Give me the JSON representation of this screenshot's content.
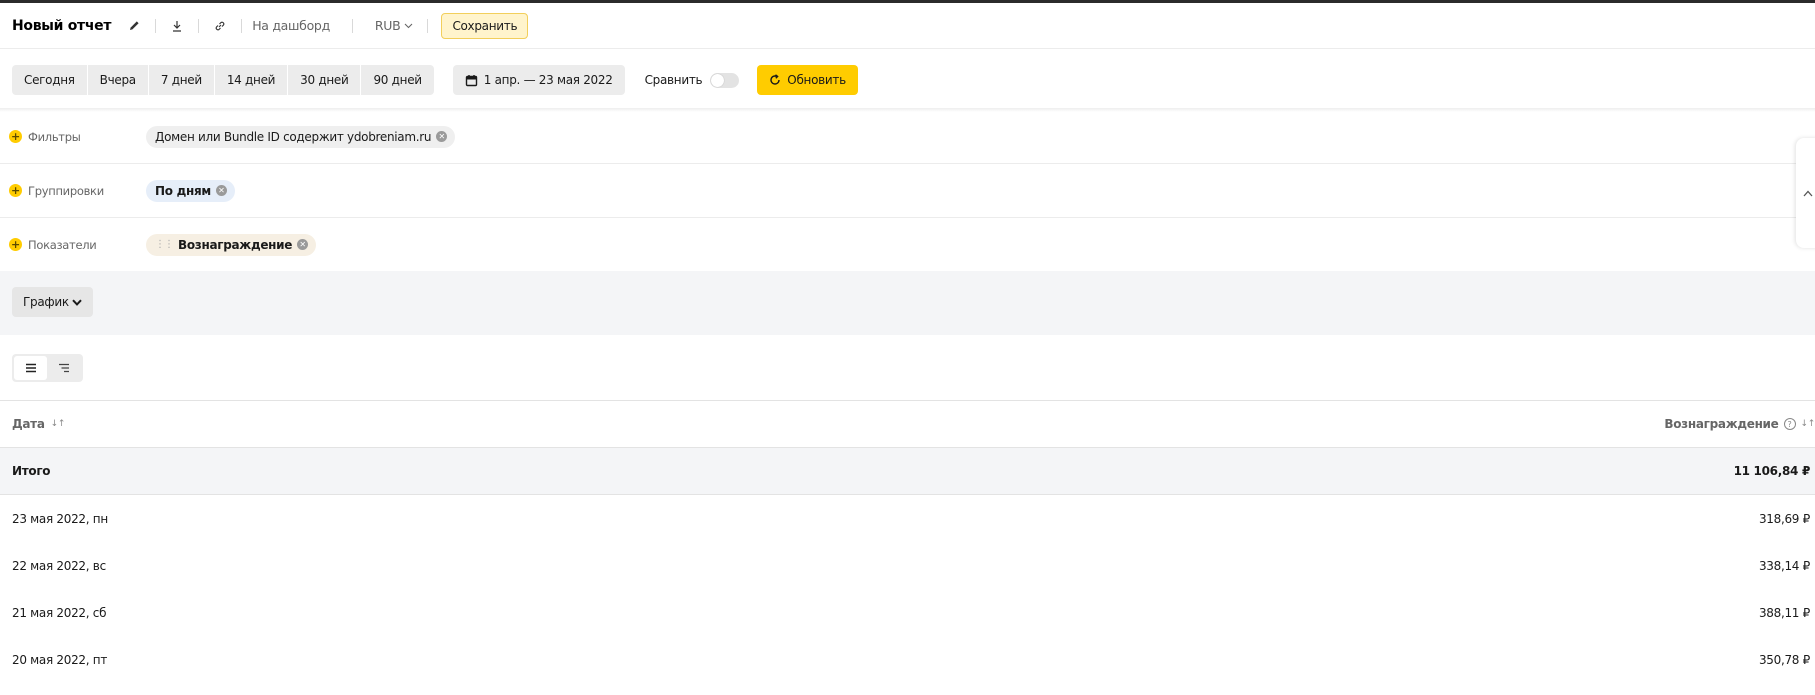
{
  "header": {
    "title": "Новый отчет",
    "dashboard_link": "На дашборд",
    "currency": "RUB",
    "save_label": "Сохранить"
  },
  "toolbar": {
    "periods": [
      "Сегодня",
      "Вчера",
      "7 дней",
      "14 дней",
      "30 дней",
      "90 дней"
    ],
    "date_range": "1 апр. — 23 мая 2022",
    "compare_label": "Сравнить",
    "compare_enabled": false,
    "refresh_label": "Обновить"
  },
  "filters": {
    "label": "Фильтры",
    "chip": "Домен или Bundle ID содержит ydobreniam.ru"
  },
  "groupings": {
    "label": "Группировки",
    "chip": "По дням"
  },
  "metrics": {
    "label": "Показатели",
    "chip": "Вознаграждение"
  },
  "chart": {
    "toggle_label": "График"
  },
  "table": {
    "columns": [
      "Дата",
      "Вознаграждение"
    ],
    "total": {
      "label": "Итого",
      "value": "11 106,84 ₽"
    },
    "rows": [
      {
        "date": "23 мая 2022, пн",
        "value": "318,69 ₽"
      },
      {
        "date": "22 мая 2022, вс",
        "value": "338,14 ₽"
      },
      {
        "date": "21 мая 2022, сб",
        "value": "388,11 ₽"
      },
      {
        "date": "20 мая 2022, пт",
        "value": "350,78 ₽"
      }
    ]
  },
  "colors": {
    "accent": "#ffcc00",
    "save_bg": "#fff4cc",
    "grouping_chip": "#e6eef9",
    "metric_chip": "#f6efe3"
  },
  "icons": [
    "pencil-icon",
    "download-icon",
    "link-icon",
    "chevron-down-icon",
    "calendar-icon",
    "refresh-icon",
    "plus-icon",
    "remove-chip-icon",
    "drag-handle-icon",
    "chevron-up-icon",
    "list-view-icon",
    "tree-view-icon",
    "sort-icon",
    "help-icon"
  ]
}
